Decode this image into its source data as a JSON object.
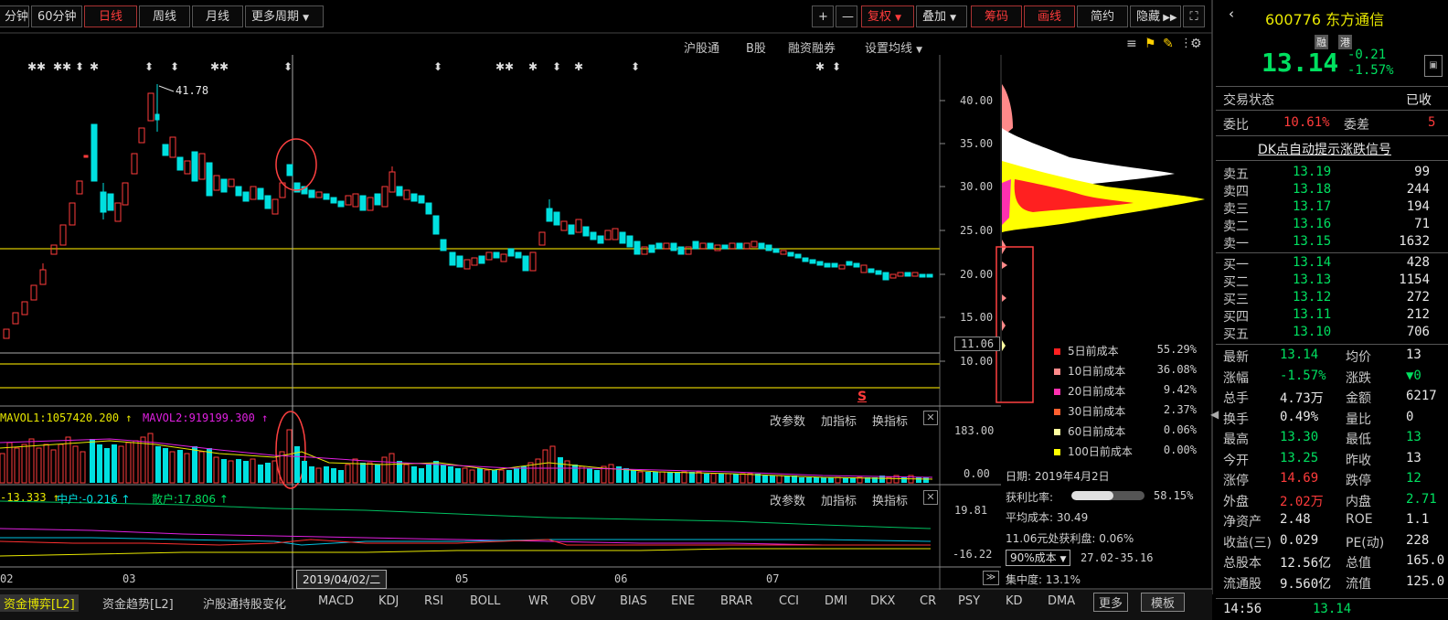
{
  "toolbar": {
    "left_buttons": [
      "分钟",
      "60分钟",
      "日线",
      "周线",
      "月线",
      "更多周期"
    ],
    "right_buttons": [
      "+",
      "—",
      "复权",
      "叠加",
      "筹码",
      "画线",
      "简约",
      "隐藏"
    ]
  },
  "subbar": [
    "沪股通",
    "B股",
    "融资融券",
    "设置均线"
  ],
  "stock": {
    "code": "600776",
    "name": "东方通信",
    "price": "13.14",
    "change": "-0.21",
    "change_pct": "-1.57%",
    "tag1": "融",
    "tag2": "港"
  },
  "price_axis": [
    "40.00",
    "35.00",
    "30.00",
    "25.00",
    "20.00",
    "15.00",
    "11.06",
    "10.00"
  ],
  "high_marker": "41.78",
  "s_marker": "S",
  "cost_legend": [
    {
      "label": "5日前成本",
      "value": "55.29%",
      "color": "#ff2020"
    },
    {
      "label": "10日前成本",
      "value": "36.08%",
      "color": "#ff8a8a"
    },
    {
      "label": "20日前成本",
      "value": "9.42%",
      "color": "#ff30b0"
    },
    {
      "label": "30日前成本",
      "value": "2.37%",
      "color": "#ff6030"
    },
    {
      "label": "60日前成本",
      "value": "0.06%",
      "color": "#ffffa0"
    },
    {
      "label": "100日前成本",
      "value": "0.00%",
      "color": "#ffff00"
    }
  ],
  "chip_info": {
    "date": "日期: 2019年4月2日",
    "profit_label": "获利比率:",
    "profit_value": "58.15%",
    "profit_ratio": 0.58,
    "avg_cost": "平均成本: 30.49",
    "at_price": "11.06元处获利盘: 0.06%",
    "select": "90%成本",
    "range": "27.02-35.16",
    "concentration": "集中度: 13.1%"
  },
  "vol_header": {
    "mavol1": "MAVOL1:1057420.200",
    "mavol2": "MAVOL2:919199.300"
  },
  "vol_axis": [
    "183.00",
    "0.00"
  ],
  "ind2_header": {
    "a": "-13.333",
    "b": "中户:-0.216",
    "c": "散户:17.806"
  },
  "ind2_axis": [
    "19.81",
    "-16.22"
  ],
  "panel_tools": [
    "改参数",
    "加指标",
    "换指标"
  ],
  "x_axis": [
    "02",
    "03",
    "05",
    "06",
    "07"
  ],
  "cursor_date": "2019/04/02/二",
  "bottom_tabs": [
    "资金博弈[L2]",
    "资金趋势[L2]",
    "沪股通持股变化",
    "MACD",
    "KDJ",
    "RSI",
    "BOLL",
    "WR",
    "OBV",
    "BIAS",
    "ENE",
    "BRAR",
    "CCI",
    "DMI",
    "DKX",
    "CR",
    "PSY",
    "KD",
    "DMA",
    "更多",
    "模板"
  ],
  "right_panel": {
    "status_label": "交易状态",
    "status_value": "已收",
    "ratio_label": "委比",
    "ratio_value": "10.61%",
    "diff_label": "委差",
    "diff_value": "5",
    "dk_title": "DK点自动提示涨跌信号",
    "sells": [
      {
        "label": "卖五",
        "price": "13.19",
        "vol": "99"
      },
      {
        "label": "卖四",
        "price": "13.18",
        "vol": "244"
      },
      {
        "label": "卖三",
        "price": "13.17",
        "vol": "194"
      },
      {
        "label": "卖二",
        "price": "13.16",
        "vol": "71"
      },
      {
        "label": "卖一",
        "price": "13.15",
        "vol": "1632"
      }
    ],
    "buys": [
      {
        "label": "买一",
        "price": "13.14",
        "vol": "428"
      },
      {
        "label": "买二",
        "price": "13.13",
        "vol": "1154"
      },
      {
        "label": "买三",
        "price": "13.12",
        "vol": "272"
      },
      {
        "label": "买四",
        "price": "13.11",
        "vol": "212"
      },
      {
        "label": "买五",
        "price": "13.10",
        "vol": "706"
      }
    ],
    "stats": [
      {
        "l1": "最新",
        "v1": "13.14",
        "c1": "g",
        "l2": "均价",
        "v2": "13",
        "c2": "w"
      },
      {
        "l1": "涨幅",
        "v1": "-1.57%",
        "c1": "g",
        "l2": "涨跌",
        "v2": "▼0",
        "c2": "g"
      },
      {
        "l1": "总手",
        "v1": "4.73万",
        "c1": "w",
        "l2": "金额",
        "v2": "6217",
        "c2": "w"
      },
      {
        "l1": "换手",
        "v1": "0.49%",
        "c1": "w",
        "l2": "量比",
        "v2": "0",
        "c2": "w"
      },
      {
        "l1": "最高",
        "v1": "13.30",
        "c1": "g",
        "l2": "最低",
        "v2": "13",
        "c2": "g"
      },
      {
        "l1": "今开",
        "v1": "13.25",
        "c1": "g",
        "l2": "昨收",
        "v2": "13",
        "c2": "w"
      },
      {
        "l1": "涨停",
        "v1": "14.69",
        "c1": "r",
        "l2": "跌停",
        "v2": "12",
        "c2": "g"
      },
      {
        "l1": "外盘",
        "v1": "2.02万",
        "c1": "r",
        "l2": "内盘",
        "v2": "2.71",
        "c2": "g"
      },
      {
        "l1": "净资产",
        "v1": "2.48",
        "c1": "w",
        "l2": "ROE",
        "v2": "1.1",
        "c2": "w"
      },
      {
        "l1": "收益(三)",
        "v1": "0.029",
        "c1": "w",
        "l2": "PE(动)",
        "v2": "228",
        "c2": "w"
      },
      {
        "l1": "总股本",
        "v1": "12.56亿",
        "c1": "w",
        "l2": "总值",
        "v2": "165.0",
        "c2": "w"
      },
      {
        "l1": "流通股",
        "v1": "9.560亿",
        "c1": "w",
        "l2": "流值",
        "v2": "125.0",
        "c2": "w"
      }
    ],
    "time": "14:56",
    "time_price": "13.14"
  }
}
